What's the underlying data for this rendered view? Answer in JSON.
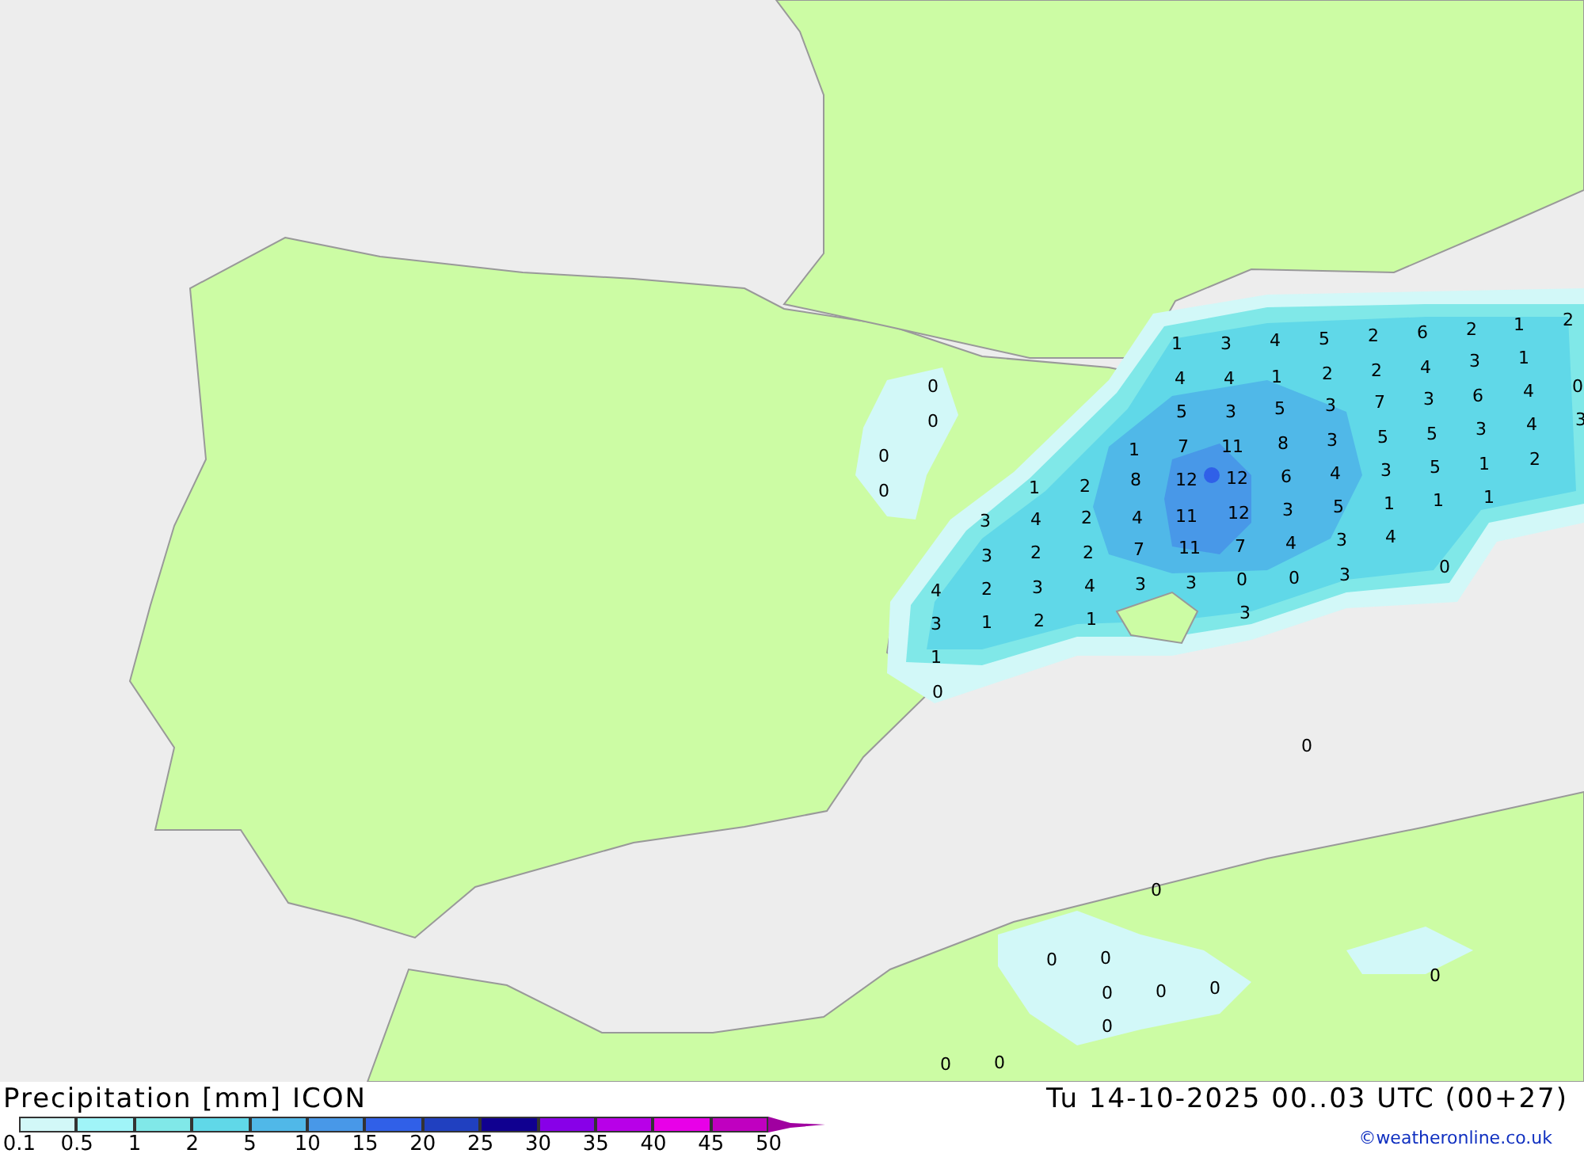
{
  "title": "Precipitation [mm] ICON",
  "timestamp": "Tu 14-10-2025 00..03 UTC (00+27)",
  "credit": "©weatheronline.co.uk",
  "legend": {
    "swatches": [
      {
        "kind": "cell",
        "color": "#d2f8f8"
      },
      {
        "kind": "cell",
        "color": "#a0f4f8"
      },
      {
        "kind": "cell",
        "color": "#80e8e8"
      },
      {
        "kind": "cell",
        "color": "#60d8e8"
      },
      {
        "kind": "cell",
        "color": "#50b8e8"
      },
      {
        "kind": "cell",
        "color": "#4898e8"
      },
      {
        "kind": "cell",
        "color": "#3060e8"
      },
      {
        "kind": "cell",
        "color": "#2040c0"
      },
      {
        "kind": "cell",
        "color": "#100090"
      },
      {
        "kind": "cell",
        "color": "#8800e8"
      },
      {
        "kind": "cell",
        "color": "#b800e8"
      },
      {
        "kind": "cell",
        "color": "#e800e8"
      },
      {
        "kind": "cell",
        "color": "#c000c0"
      },
      {
        "kind": "arrow",
        "color": "#a000a0"
      }
    ],
    "labels": [
      "0.1",
      "0.5",
      "1",
      "2",
      "5",
      "10",
      "15",
      "20",
      "25",
      "30",
      "35",
      "40",
      "45",
      "50"
    ]
  },
  "map_labels": [
    "1",
    "3",
    "4",
    "5",
    "2",
    "6",
    "2",
    "1",
    "2",
    "4",
    "4",
    "1",
    "2",
    "2",
    "4",
    "3",
    "1",
    "5",
    "3",
    "5",
    "3",
    "7",
    "3",
    "6",
    "4",
    "0",
    "7",
    "11",
    "8",
    "3",
    "5",
    "5",
    "3",
    "4",
    "3",
    "1",
    "1",
    "2",
    "8",
    "12",
    "12",
    "6",
    "4",
    "3",
    "5",
    "1",
    "2",
    "3",
    "4",
    "2",
    "4",
    "11",
    "12",
    "3",
    "5",
    "1",
    "1",
    "1",
    "3",
    "2",
    "2",
    "7",
    "11",
    "7",
    "4",
    "3",
    "4",
    "4",
    "2",
    "3",
    "4",
    "3",
    "3",
    "0",
    "0",
    "3",
    "0",
    "3",
    "1",
    "2",
    "1",
    "3",
    "1",
    "0",
    "0",
    "0",
    "0",
    "0",
    "0",
    "0",
    "0",
    "0",
    "0",
    "0",
    "0",
    "0",
    "0",
    "0",
    "0"
  ]
}
